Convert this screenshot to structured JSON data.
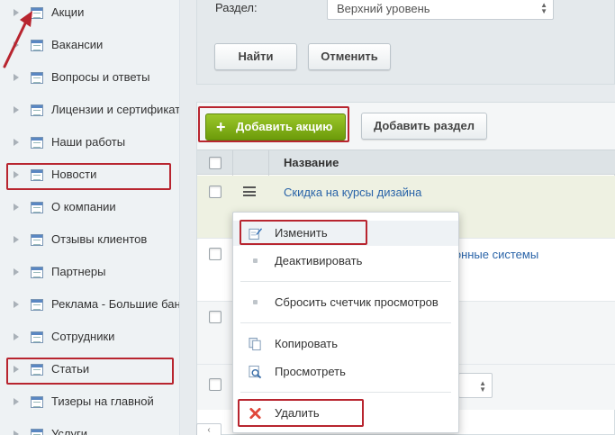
{
  "sidebar": {
    "items": [
      {
        "label": "Акции"
      },
      {
        "label": "Вакансии"
      },
      {
        "label": "Вопросы и ответы"
      },
      {
        "label": "Лицензии и сертификаты"
      },
      {
        "label": "Наши работы"
      },
      {
        "label": "Новости"
      },
      {
        "label": "О компании"
      },
      {
        "label": "Отзывы клиентов"
      },
      {
        "label": "Партнеры"
      },
      {
        "label": "Реклама - Большие баннеры"
      },
      {
        "label": "Сотрудники"
      },
      {
        "label": "Статьи"
      },
      {
        "label": "Тизеры на главной"
      },
      {
        "label": "Услуги"
      }
    ]
  },
  "filter": {
    "section_label": "Раздел:",
    "section_value": "Верхний уровень",
    "find_label": "Найти",
    "cancel_label": "Отменить"
  },
  "toolbar": {
    "add_action_label": "Добавить акцию",
    "add_section_label": "Добавить раздел"
  },
  "table": {
    "column_title": "Название",
    "rows": [
      {
        "title": "Скидка на курсы дизайна"
      },
      {
        "title": "конные системы"
      }
    ]
  },
  "context_menu": {
    "items": [
      {
        "label": "Изменить",
        "icon": "edit-icon"
      },
      {
        "label": "Деактивировать",
        "icon": "dot"
      },
      {
        "label": "Сбросить счетчик просмотров",
        "icon": "dot"
      },
      {
        "label": "Копировать",
        "icon": "copy-icon"
      },
      {
        "label": "Просмотреть",
        "icon": "view-icon"
      },
      {
        "label": "Удалить",
        "icon": "delete-icon"
      }
    ]
  },
  "colors": {
    "highlight": "#b8252f",
    "accent_green": "#7aab14",
    "link": "#2a64a8"
  }
}
